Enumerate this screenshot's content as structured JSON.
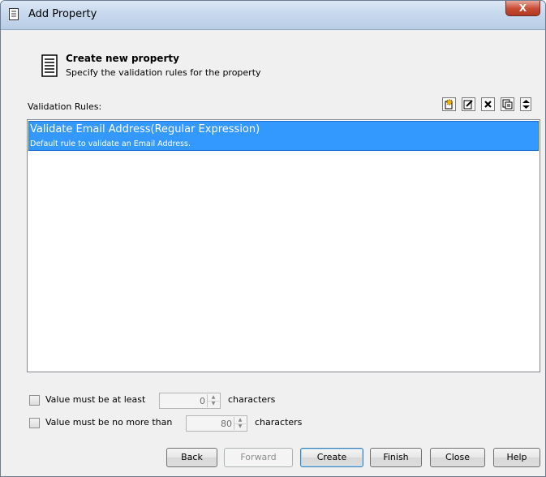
{
  "window": {
    "title": "Add Property",
    "title_icon": "document-icon",
    "close_glyph": "X"
  },
  "header": {
    "icon": "document-lines-icon",
    "title": "Create new property",
    "subtitle": "Specify the validation rules for the property"
  },
  "rules": {
    "label": "Validation Rules:",
    "toolbar": [
      "new-rule-icon",
      "edit-rule-icon",
      "delete-icon",
      "copy-icon",
      "move-up-down-icon"
    ],
    "items": [
      {
        "title": "Validate Email Address(Regular Expression)",
        "description": "Default rule to validate an Email Address.",
        "selected": true
      }
    ]
  },
  "options": {
    "min": {
      "label": "Value must be at least",
      "value": "0",
      "suffix": "characters",
      "checked": false
    },
    "max": {
      "label": "Value must be no more than",
      "value": "80",
      "suffix": "characters",
      "checked": false
    }
  },
  "buttons": {
    "back": "Back",
    "forward": "Forward",
    "create": "Create",
    "finish": "Finish",
    "close": "Close",
    "help": "Help"
  },
  "colors": {
    "selection": "#3399ff",
    "titlebar": "#c8d9ee",
    "close_button": "#c84a32"
  }
}
